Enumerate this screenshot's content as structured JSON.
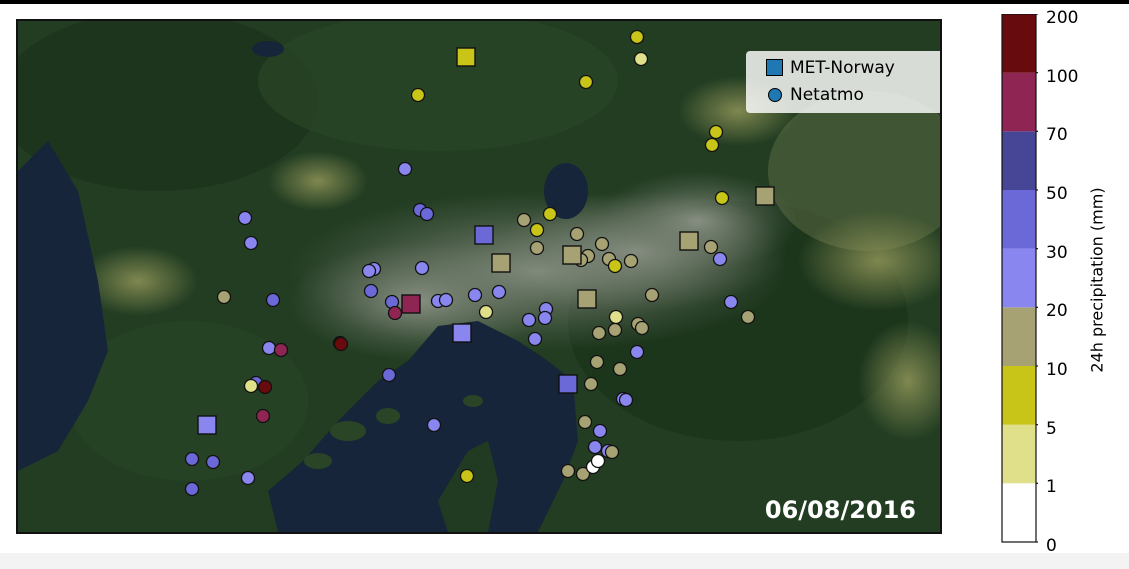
{
  "chart_data": {
    "type": "scatter",
    "date_label": "06/08/2016",
    "legend": {
      "placement": "top-right",
      "entries": [
        {
          "label": "MET-Norway",
          "marker": "square"
        },
        {
          "label": "Netatmo",
          "marker": "circle"
        }
      ]
    },
    "colorbar": {
      "label": "24h precipitation (mm)",
      "bounds": [
        "0",
        "1",
        "5",
        "10",
        "20",
        "30",
        "50",
        "70",
        "100",
        "200"
      ],
      "colors": [
        "#ffffff",
        "#e0df8a",
        "#c8c418",
        "#a6a273",
        "#8a86f0",
        "#6b69d8",
        "#474696",
        "#8f2553",
        "#680b0e"
      ]
    },
    "met_norway_stations": [
      {
        "bin": 2,
        "note": "north"
      },
      {
        "bin": 5,
        "note": "centre"
      },
      {
        "bin": 3,
        "note": "centre"
      },
      {
        "bin": 3,
        "note": "centre"
      },
      {
        "bin": 3,
        "note": "east"
      },
      {
        "bin": 3,
        "note": "east"
      },
      {
        "bin": 3,
        "note": "centre"
      },
      {
        "bin": 7,
        "note": "west"
      },
      {
        "bin": 4,
        "note": "centre"
      },
      {
        "bin": 5,
        "note": "south-east"
      },
      {
        "bin": 4,
        "note": "south-west"
      }
    ],
    "netatmo_stations_count": 89
  },
  "colors": {
    "water": "#17253a",
    "forest": "#1f3a20",
    "urban": "#6b7565",
    "field": "#7d8a4c"
  }
}
